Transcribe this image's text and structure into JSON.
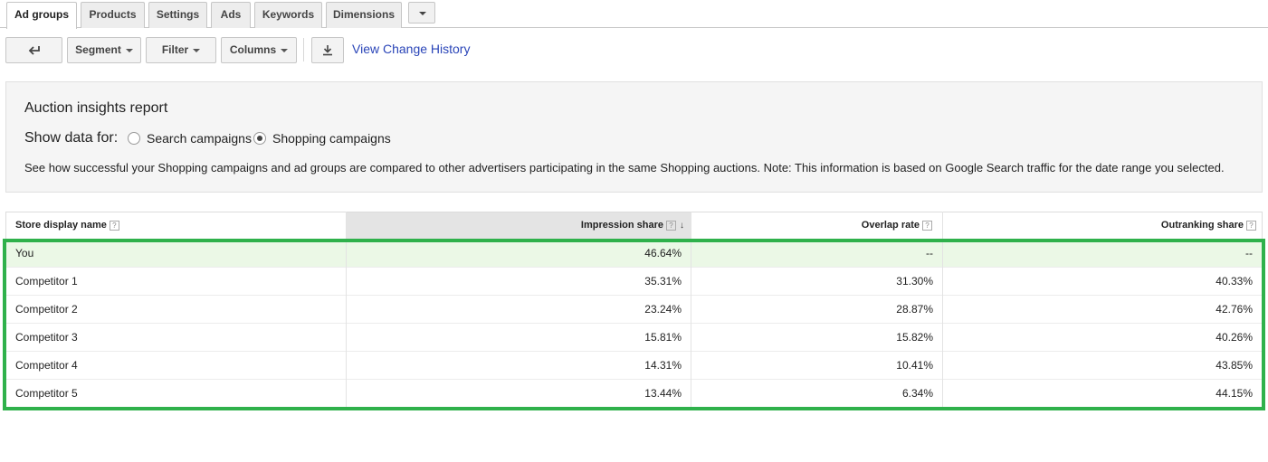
{
  "tabs": [
    {
      "label": "Ad groups",
      "active": true
    },
    {
      "label": "Products",
      "active": false
    },
    {
      "label": "Settings",
      "active": false
    },
    {
      "label": "Ads",
      "active": false
    },
    {
      "label": "Keywords",
      "active": false
    },
    {
      "label": "Dimensions",
      "active": false
    }
  ],
  "toolbar": {
    "back_icon": "back-arrow-icon",
    "segment_label": "Segment",
    "filter_label": "Filter",
    "columns_label": "Columns",
    "download_icon": "download-icon",
    "history_link": "View Change History"
  },
  "panel": {
    "title": "Auction insights report",
    "show_data_for": "Show data for:",
    "options": [
      "Search campaigns",
      "Shopping campaigns"
    ],
    "selected_option": "Shopping campaigns",
    "description": "See how successful your Shopping campaigns and ad groups are compared to other advertisers participating in the same Shopping auctions. Note: This information is based on Google Search traffic for the date range you selected."
  },
  "table": {
    "columns": [
      "Store display name",
      "Impression share",
      "Overlap rate",
      "Outranking share"
    ],
    "help_glyph": "?",
    "sort_glyph": "↓",
    "sorted_column": "Impression share",
    "rows": [
      [
        "You",
        "46.64%",
        "--",
        "--"
      ],
      [
        "Competitor 1",
        "35.31%",
        "31.30%",
        "40.33%"
      ],
      [
        "Competitor 2",
        "23.24%",
        "28.87%",
        "42.76%"
      ],
      [
        "Competitor 3",
        "15.81%",
        "15.82%",
        "40.26%"
      ],
      [
        "Competitor 4",
        "14.31%",
        "10.41%",
        "43.85%"
      ],
      [
        "Competitor 5",
        "13.44%",
        "6.34%",
        "44.15%"
      ]
    ]
  },
  "colors": {
    "highlight_border": "#2fb14b",
    "you_row_bg": "#ebf8e6",
    "link": "#2a45b8"
  }
}
